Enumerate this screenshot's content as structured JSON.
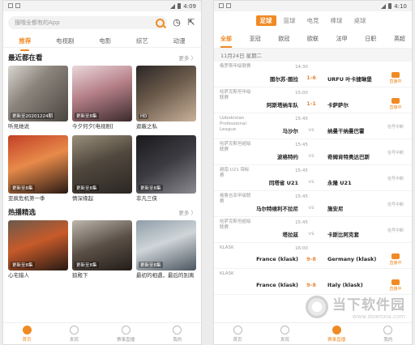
{
  "left": {
    "status_time": "4:09",
    "search_placeholder": "搜哦全都有的App",
    "tabs": [
      "推荐",
      "电视剧",
      "电影",
      "综艺",
      "动漫"
    ],
    "section1": {
      "title": "最近都在看",
      "more": "更多 〉"
    },
    "row1": [
      {
        "caption": "更新至20201224期",
        "name": "听見她说"
      },
      {
        "caption": "更新至8集",
        "name": "今夕何夕[电视剧]"
      },
      {
        "caption": "HD",
        "name": "遮蔽之私"
      }
    ],
    "row2": [
      {
        "caption": "更新至8集",
        "name": "亚疯危机第一季"
      },
      {
        "caption": "更新至8集",
        "name": "情深缘起"
      },
      {
        "caption": "更新至8集",
        "name": "非凡三侠"
      }
    ],
    "section2": {
      "title": "热播精选",
      "more": "更多 〉"
    },
    "row3": [
      {
        "caption": "更新至8集",
        "name": "心宅猎人"
      },
      {
        "caption": "更新至8集",
        "name": "狼殿下"
      },
      {
        "caption": "更新至8集",
        "name": "最初的相遇，最后的别离"
      }
    ],
    "nav": [
      "首页",
      "发现",
      "赛事直播",
      "我的"
    ]
  },
  "right": {
    "status_time": "4:10",
    "sport_tabs": [
      "足球",
      "篮球",
      "电竞",
      "棒球",
      "桌球"
    ],
    "league_tabs": [
      "全部",
      "亚冠",
      "欧冠",
      "欧联",
      "法甲",
      "日职",
      "英超"
    ],
    "date": "11月24日 星期二",
    "matches": [
      {
        "league": "俄罗斯甲级联赛",
        "time": "14:30",
        "home": "图尔苏·图拉",
        "score": "1-6",
        "away": "URFU 叶卡捷琳堡",
        "status": "直播中"
      },
      {
        "league": "哈萨克斯坦甲级联赛",
        "time": "15:00",
        "home": "阿斯塔纳车队",
        "score": "1-1",
        "away": "卡萨萨尔",
        "status": "直播中"
      },
      {
        "league": "Uzbekistan Professional League",
        "time": "15:45",
        "home": "马沙尔",
        "score": "vs",
        "away": "纳曼干纳曼巴霍",
        "status": "信号中断"
      },
      {
        "league": "哈萨克斯坦超级联赛",
        "time": "15:45",
        "home": "波格特约",
        "score": "vs",
        "away": "奇姆肯特奥达巴斯",
        "status": "信号中断"
      },
      {
        "league": "越南 U21 锦标赛",
        "time": "15:45",
        "home": "同塔省 U21",
        "score": "vs",
        "away": "永隆 U21",
        "status": "信号中断"
      },
      {
        "league": "格鲁吉亚甲级联赛",
        "time": "15:45",
        "home": "马尔特维利不拉尼",
        "score": "vs",
        "away": "施安尼",
        "status": "信号中断"
      },
      {
        "league": "哈萨克斯坦超级联赛",
        "time": "15:45",
        "home": "塔拉兹",
        "score": "vs",
        "away": "卡斯比阿克套",
        "status": "信号中断"
      },
      {
        "league": "KLASK",
        "time": "16:00",
        "home": "France (klask)",
        "score": "9-8",
        "away": "Germany (klask)",
        "status": "直播中"
      },
      {
        "league": "KLASK",
        "time": "",
        "home": "France (klask)",
        "score": "9-8",
        "away": "Italy (klask)",
        "status": "直播中"
      }
    ],
    "nav": [
      "首页",
      "发现",
      "赛事直播",
      "我的"
    ],
    "watermark": {
      "cn": "当下软件园",
      "en": "www.downxia.com"
    }
  }
}
